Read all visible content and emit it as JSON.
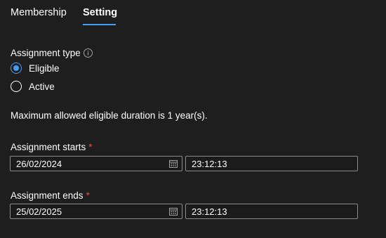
{
  "tabs": [
    {
      "label": "Membership",
      "active": false
    },
    {
      "label": "Setting",
      "active": true
    }
  ],
  "assignment_type": {
    "label": "Assignment type",
    "options": [
      {
        "label": "Eligible",
        "checked": true
      },
      {
        "label": "Active",
        "checked": false
      }
    ]
  },
  "notice": "Maximum allowed eligible duration is 1 year(s).",
  "assignment_starts": {
    "label": "Assignment starts",
    "required_mark": "*",
    "date": "26/02/2024",
    "time": "23:12:13"
  },
  "assignment_ends": {
    "label": "Assignment ends",
    "required_mark": "*",
    "date": "25/02/2025",
    "time": "23:12:13"
  },
  "colors": {
    "accent": "#479ef5",
    "required": "#e74c4c",
    "background": "#1e1e1e"
  }
}
